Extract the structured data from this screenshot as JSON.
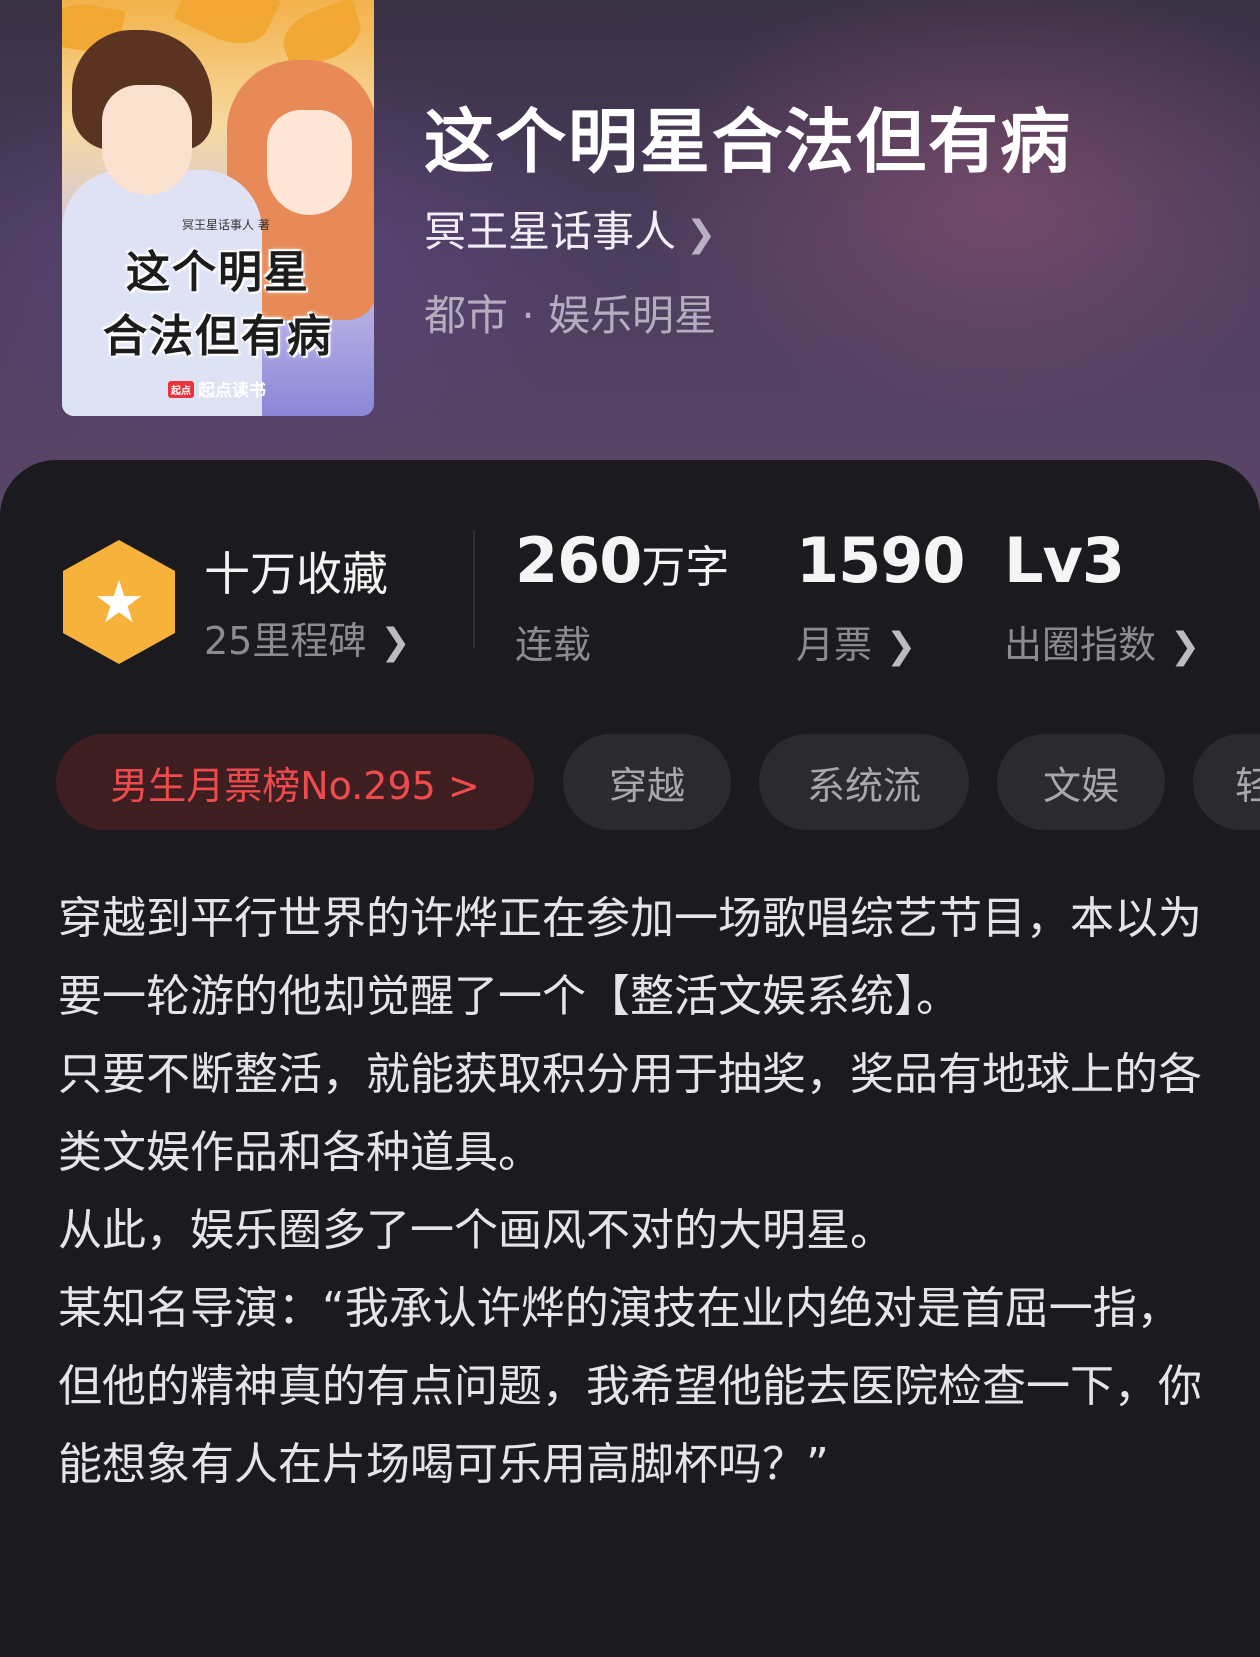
{
  "book": {
    "title": "这个明星合法但有病",
    "author": "冥王星话事人",
    "genre": "都市 · 娱乐明星",
    "cover": {
      "title_line1": "这个明星",
      "title_line2": "合法但有病",
      "author_tag": "冥王星话事人 著",
      "brand_logo": "起点",
      "brand": "起点读书"
    }
  },
  "stats": {
    "collection": {
      "title": "十万收藏",
      "sub": "25里程碑",
      "icon": "star-badge-icon"
    },
    "words": {
      "value": "260",
      "unit": "万字",
      "label": "连载"
    },
    "tickets": {
      "value": "1590",
      "label": "月票"
    },
    "influence": {
      "value": "Lv3",
      "label": "出圈指数"
    }
  },
  "tags": {
    "rank": "男生月票榜No.295 >",
    "items": [
      "穿越",
      "系统流",
      "文娱",
      "轻"
    ]
  },
  "description": [
    "穿越到平行世界的许烨正在参加一场歌唱综艺节目，本以为要一轮游的他却觉醒了一个【整活文娱系统】。",
    "只要不断整活，就能获取积分用于抽奖，奖品有地球上的各类文娱作品和各种道具。",
    "从此，娱乐圈多了一个画风不对的大明星。",
    "某知名导演：“我承认许烨的演技在业内绝对是首屈一指，但他的精神真的有点问题，我希望他能去医院检查一下，你能想象有人在片场喝可乐用高脚杯吗？”"
  ],
  "colors": {
    "accent_red": "#ef4b4d",
    "badge_gold": "#f6b23a",
    "panel_bg": "#1b1a1e"
  }
}
